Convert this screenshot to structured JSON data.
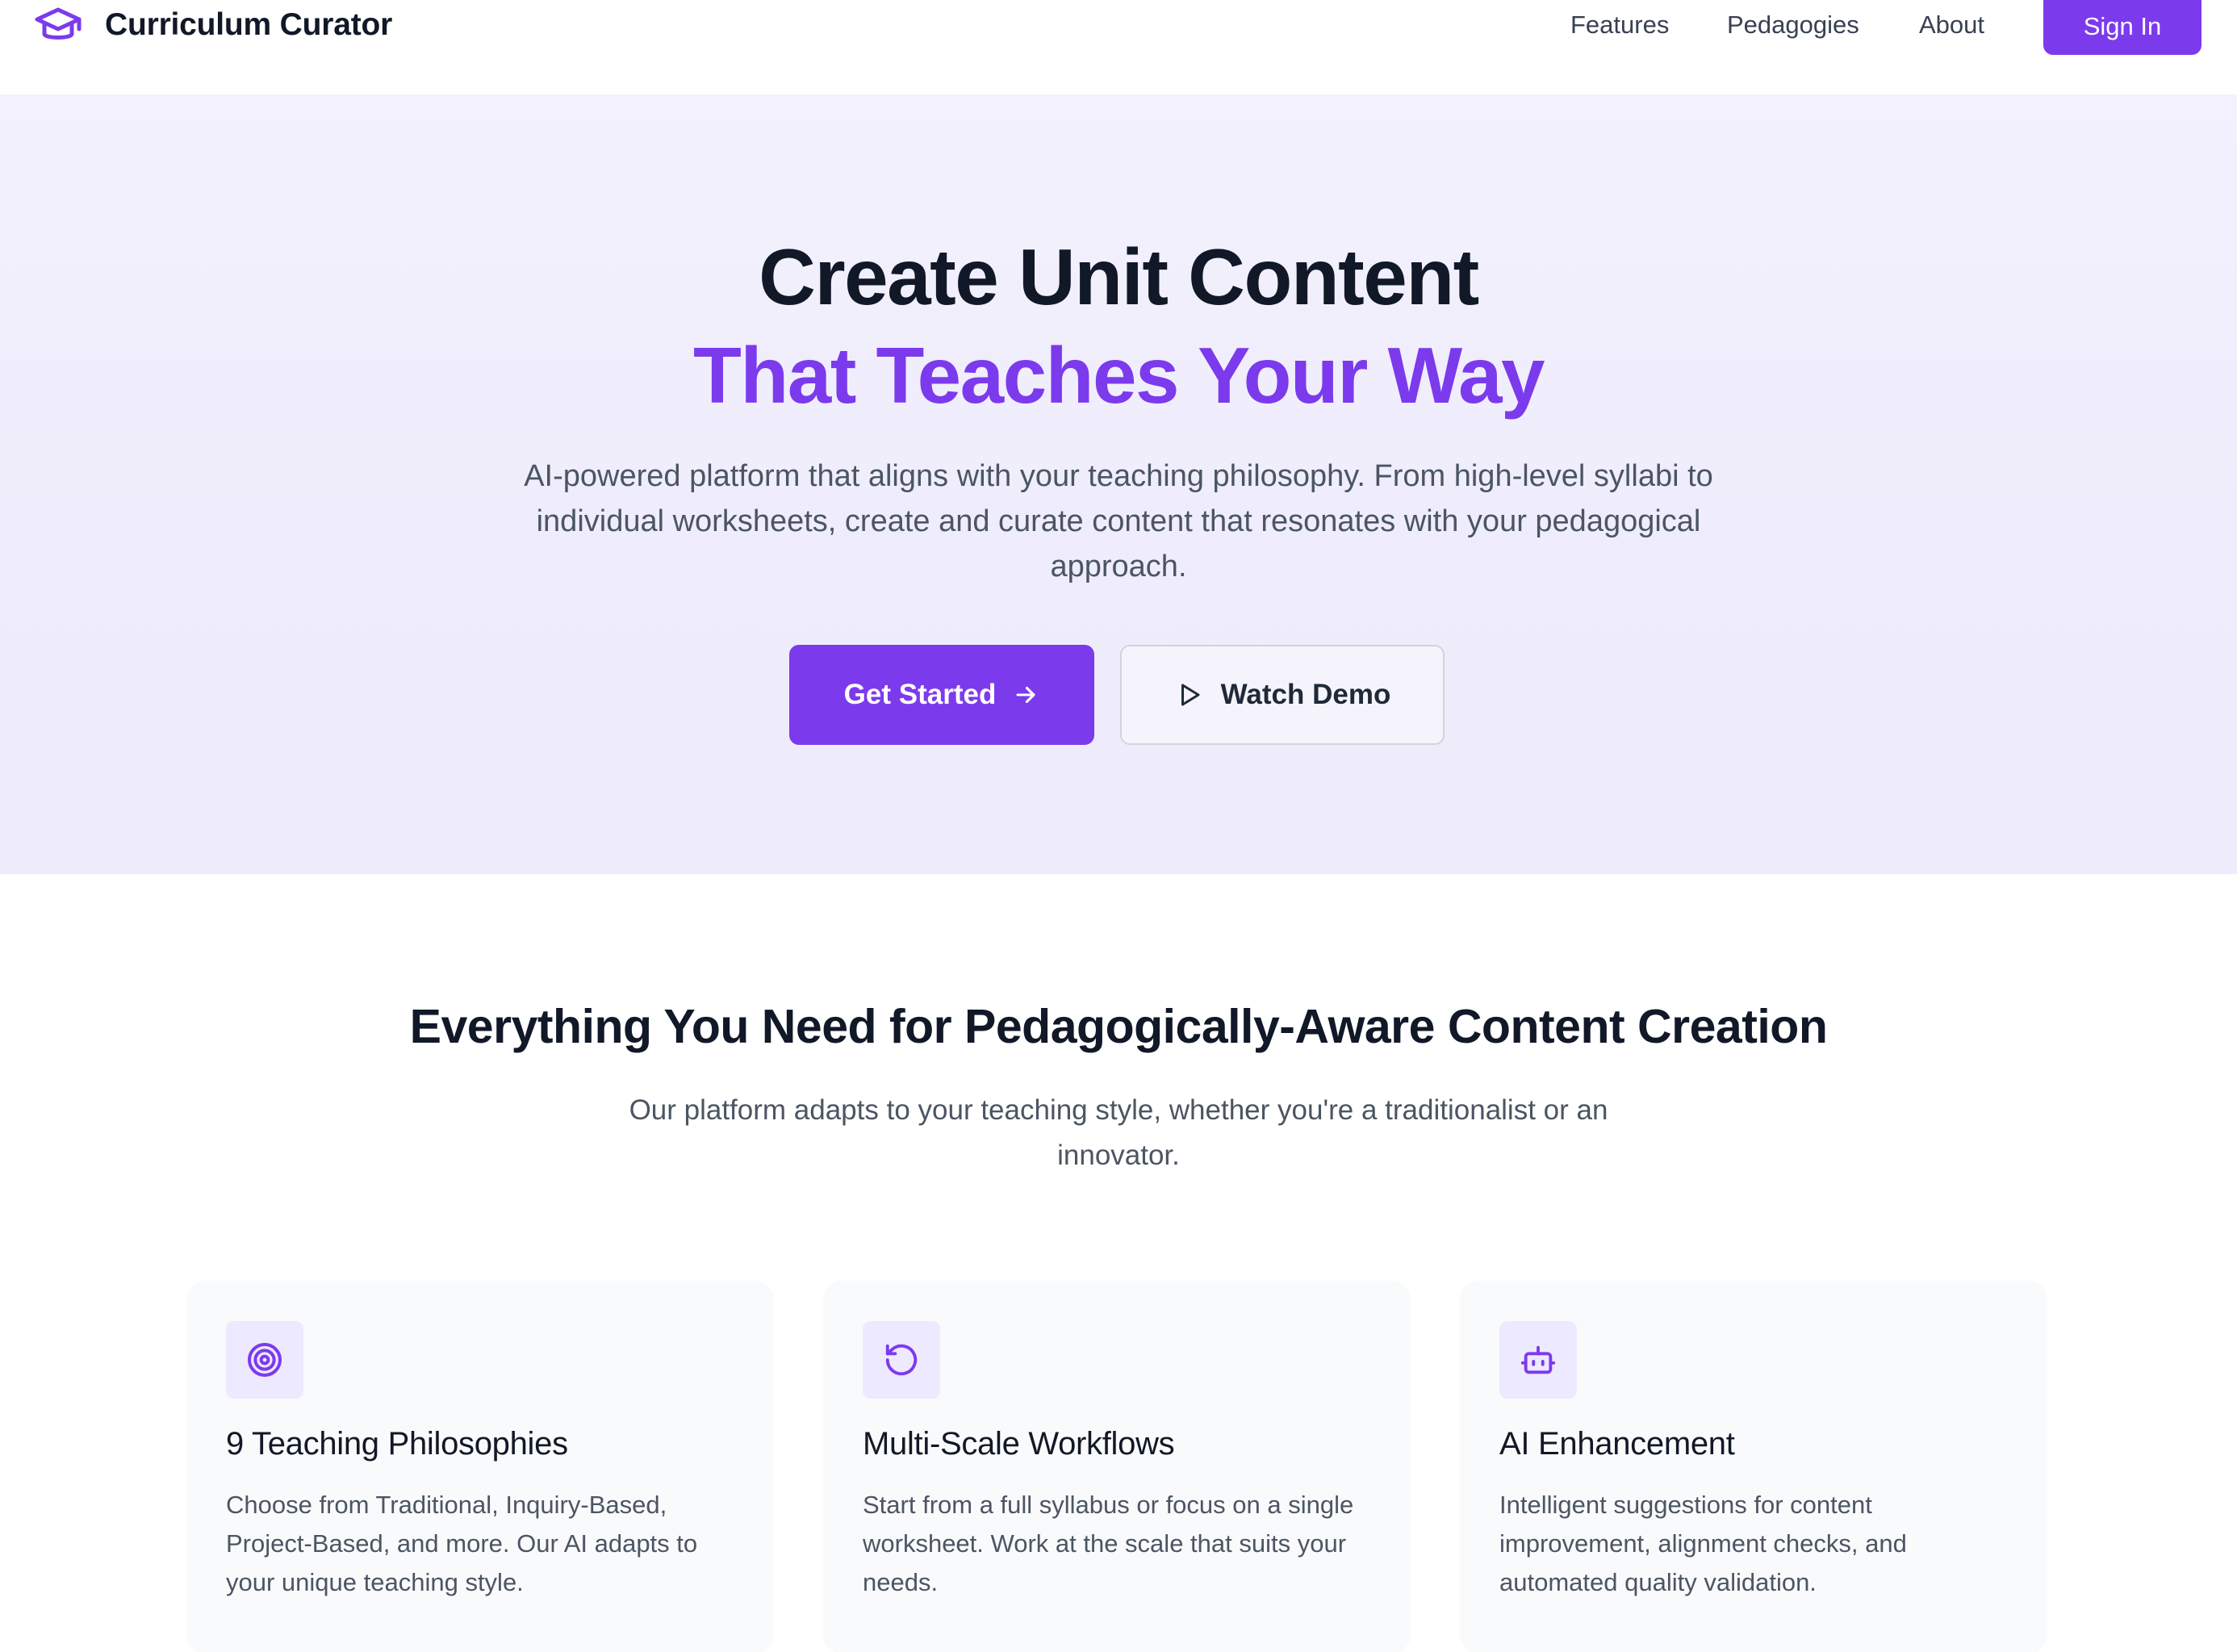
{
  "nav": {
    "brand": "Curriculum Curator",
    "links": [
      "Features",
      "Pedagogies",
      "About"
    ],
    "signin": "Sign In"
  },
  "hero": {
    "title_line1": "Create Unit Content",
    "title_line2": "That Teaches Your Way",
    "description": "AI-powered platform that aligns with your teaching philosophy. From high-level syllabi to individual worksheets, create and curate content that resonates with your pedagogical approach.",
    "primary_cta": "Get Started",
    "secondary_cta": "Watch Demo"
  },
  "features": {
    "title": "Everything You Need for Pedagogically-Aware Content Creation",
    "subtitle": "Our platform adapts to your teaching style, whether you're a traditionalist or an innovator.",
    "cards": [
      {
        "icon": "target-icon",
        "title": "9 Teaching Philosophies",
        "text": "Choose from Traditional, Inquiry-Based, Project-Based, and more. Our AI adapts to your unique teaching style."
      },
      {
        "icon": "rotate-ccw-icon",
        "title": "Multi-Scale Workflows",
        "text": "Start from a full syllabus or focus on a single worksheet. Work at the scale that suits your needs."
      },
      {
        "icon": "bot-icon",
        "title": "AI Enhancement",
        "text": "Intelligent suggestions for content improvement, alignment checks, and automated quality validation."
      }
    ]
  },
  "colors": {
    "accent": "#7c3aed",
    "accent_light": "#ede9fe",
    "text_dark": "#111827",
    "text_muted": "#4b5563",
    "hero_bg": "#f1effc"
  }
}
